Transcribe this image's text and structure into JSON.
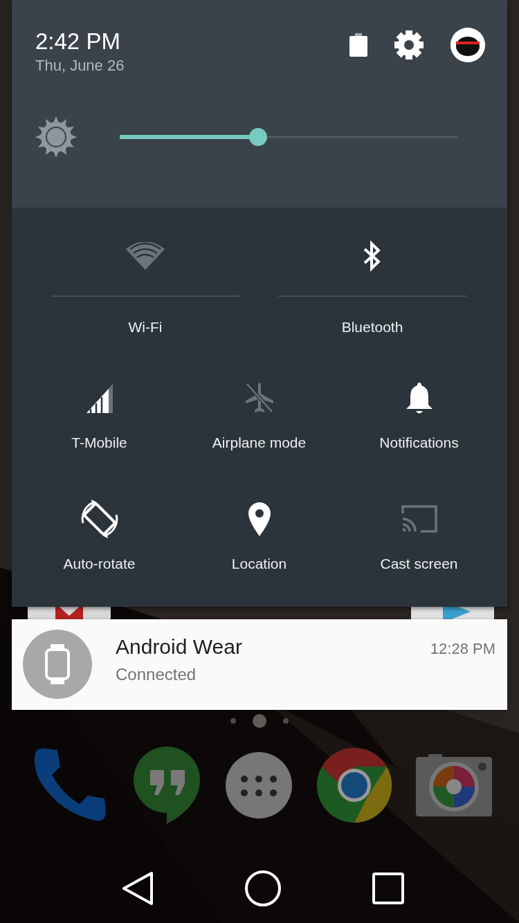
{
  "header": {
    "time": "2:42 PM",
    "date": "Thu, June 26"
  },
  "brightness": {
    "level": 0.41
  },
  "tiles": [
    {
      "kind": "wifi",
      "label": "Wi-Fi",
      "on": false
    },
    {
      "kind": "bluetooth",
      "label": "Bluetooth",
      "on": true
    },
    {
      "kind": "signal",
      "label": "T-Mobile",
      "on": true
    },
    {
      "kind": "airplane",
      "label": "Airplane mode",
      "on": false
    },
    {
      "kind": "bell",
      "label": "Notifications",
      "on": true
    },
    {
      "kind": "rotate",
      "label": "Auto-rotate",
      "on": true
    },
    {
      "kind": "location",
      "label": "Location",
      "on": true
    },
    {
      "kind": "cast",
      "label": "Cast screen",
      "on": false
    }
  ],
  "notification": {
    "title": "Android Wear",
    "text": "Connected",
    "time": "12:28 PM"
  },
  "pages": [
    {
      "selected": false
    },
    {
      "selected": true
    },
    {
      "selected": false
    }
  ],
  "dock": [
    {
      "kind": "phone"
    },
    {
      "kind": "chat"
    },
    {
      "kind": "apps"
    },
    {
      "kind": "browser"
    },
    {
      "kind": "camera"
    }
  ]
}
